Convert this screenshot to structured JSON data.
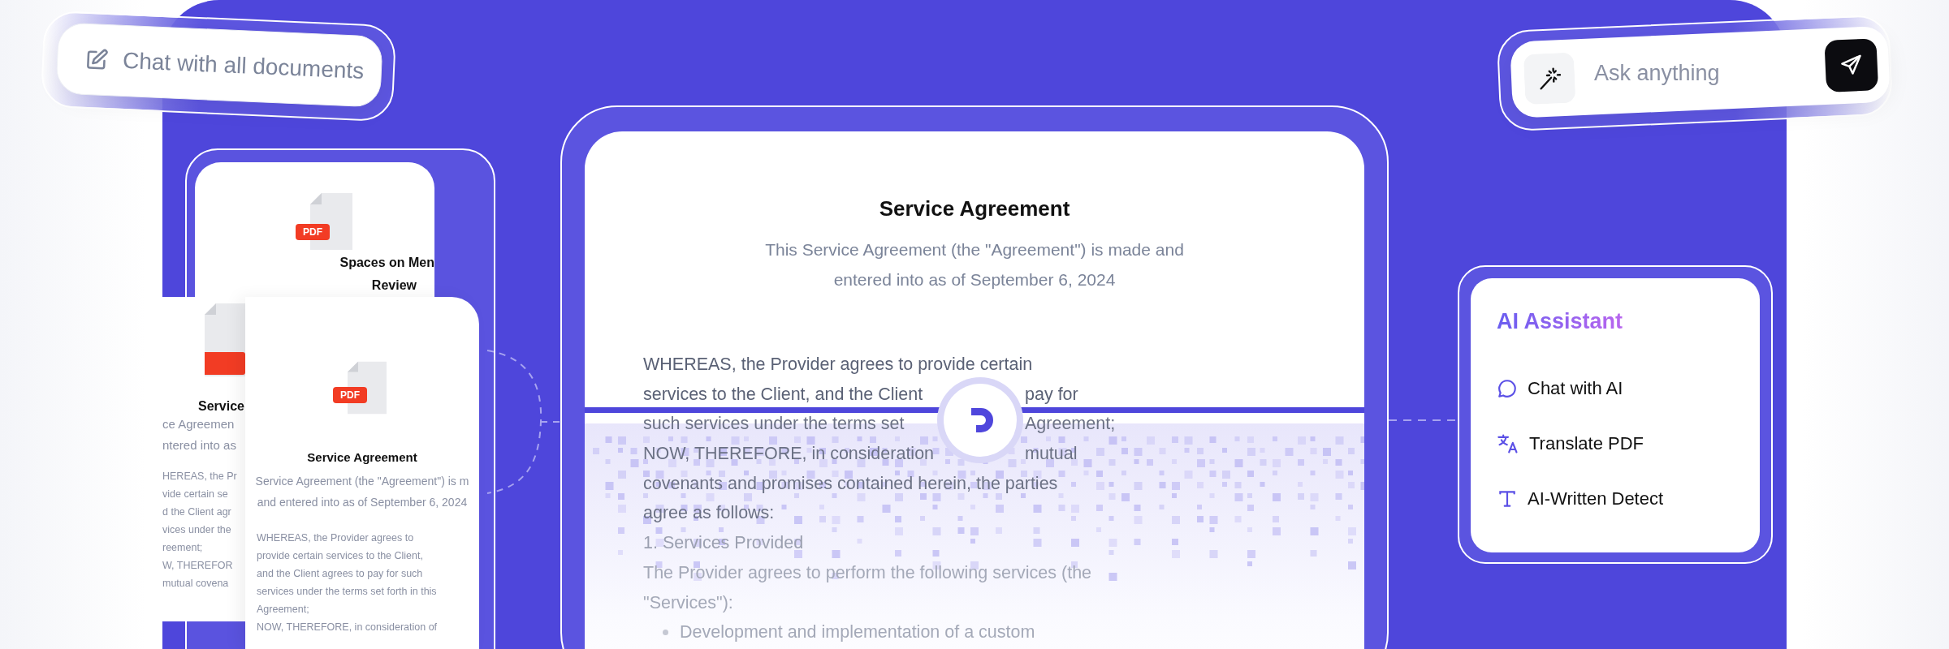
{
  "chat_pill": {
    "label": "Chat with all documents"
  },
  "ask_bar": {
    "placeholder": "Ask anything"
  },
  "back_card": {
    "badge": "PDF",
    "title_lines": [
      "Spaces on Men",
      "Review"
    ]
  },
  "middle_card": {
    "title": "Service",
    "subtitle_lines": [
      "ce Agreemen",
      "ntered into as"
    ],
    "body_lines": [
      "HEREAS, the Pr",
      "vide certain se",
      "d the Client agr",
      "vices under the",
      "reement;",
      "W, THEREFOR",
      "mutual covena"
    ]
  },
  "front_card": {
    "badge": "PDF",
    "title": "Service Agreement",
    "subtitle_lines": [
      "Service Agreement (the \"Agreement\") is m",
      "and entered into as of September 6, 2024"
    ],
    "body_lines": [
      "WHEREAS, the Provider agrees to",
      "provide certain services to the Client,",
      "and the Client agrees to pay for such",
      "services under the terms set forth in this",
      "Agreement;",
      "NOW, THEREFORE, in consideration of"
    ]
  },
  "document": {
    "title": "Service Agreement",
    "subtitle_lines": [
      "This Service Agreement (the \"Agreement\") is made and",
      "entered into as of September 6, 2024"
    ],
    "body_lines": [
      {
        "parts": [
          "WHEREAS, the Provider agrees to provide certain"
        ]
      },
      {
        "parts": [
          "services to the Client, and the Client",
          "pay for"
        ]
      },
      {
        "parts": [
          "such services under the terms set",
          "Agreement;"
        ]
      },
      {
        "parts": [
          "NOW, THEREFORE, in consideration",
          "mutual"
        ]
      },
      {
        "parts": [
          "covenants and promises contained herein, the parties"
        ]
      },
      {
        "parts": [
          "agree as follows:"
        ]
      },
      {
        "parts": [
          "1. Services Provided"
        ]
      },
      {
        "parts": [
          "The Provider agrees to perform the following services (the"
        ]
      },
      {
        "parts": [
          "\"Services\"):"
        ]
      }
    ],
    "bullets": [
      "Development and implementation of a custom"
    ]
  },
  "assistant": {
    "title": "AI Assistant",
    "items": [
      {
        "kind": "chat",
        "label": "Chat with AI"
      },
      {
        "kind": "translate",
        "label": "Translate PDF"
      },
      {
        "kind": "text",
        "label": "AI-Written Detect"
      }
    ]
  }
}
